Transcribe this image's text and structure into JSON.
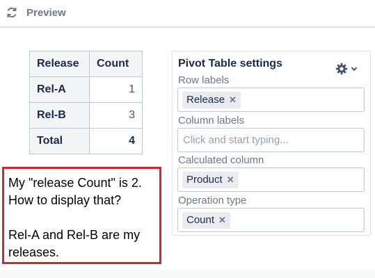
{
  "header": {
    "title": "Preview"
  },
  "table": {
    "headers": [
      "Release",
      "Count"
    ],
    "rows": [
      {
        "label": "Rel-A",
        "count": "1"
      },
      {
        "label": "Rel-B",
        "count": "3"
      },
      {
        "label": "Total",
        "count": "4"
      }
    ]
  },
  "note": {
    "line1": "My \"release Count\" is 2.",
    "line2": "How to display that?",
    "line3": "Rel-A and Rel-B are my",
    "line4": "releases."
  },
  "settings": {
    "title": "Pivot Table settings",
    "row_labels": {
      "label": "Row labels",
      "tag": "Release",
      "remove": "✕"
    },
    "column_labels": {
      "label": "Column labels",
      "placeholder": "Click and start typing..."
    },
    "calculated_column": {
      "label": "Calculated column",
      "tag": "Product",
      "remove": "✕"
    },
    "operation_type": {
      "label": "Operation type",
      "tag": "Count",
      "remove": "✕"
    }
  }
}
